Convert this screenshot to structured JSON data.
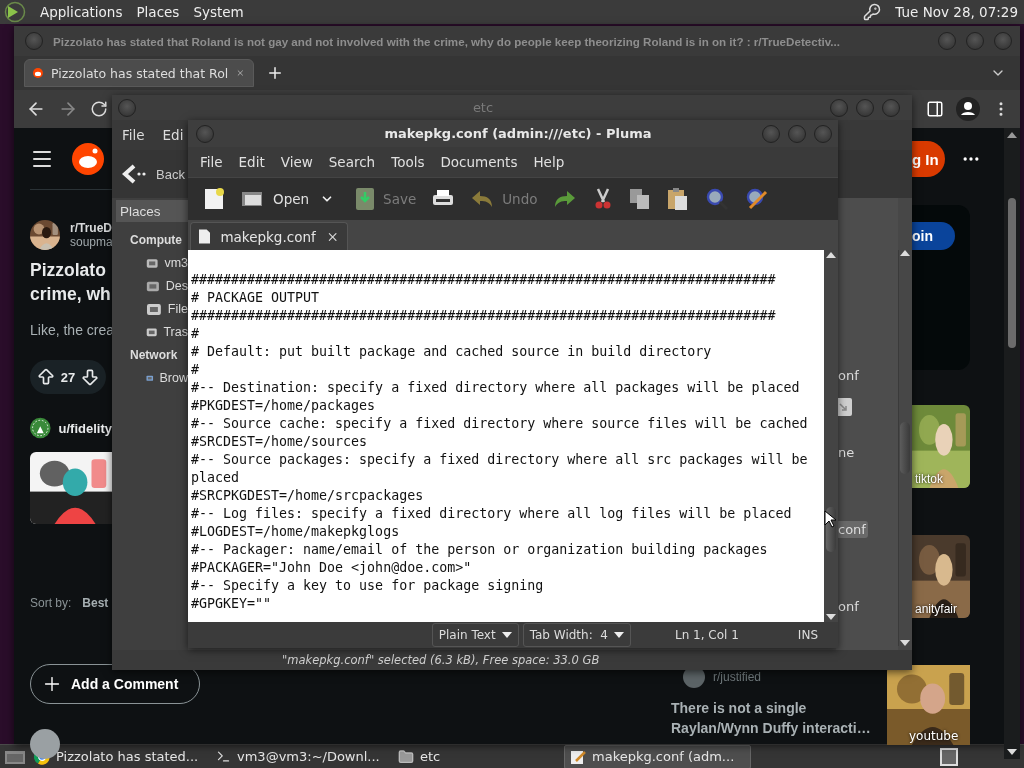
{
  "top_panel": {
    "menus": [
      "Applications",
      "Places",
      "System"
    ],
    "clock": "Tue Nov 28, 07:29"
  },
  "browser": {
    "title": "Pizzolato has stated that Roland is not gay and not involved with the crime, why do people keep theorizing Roland is in on it? : r/TrueDetectiv...",
    "tabs": [
      {
        "title": "Pizzolato has stated that Rol",
        "selected": true
      }
    ],
    "post": {
      "subreddit": "r/TrueD",
      "author": "soupma",
      "title_lines": [
        "Pizzolato",
        "crime, wh"
      ],
      "body": "Like, the crea",
      "votes": "27"
    },
    "ad": {
      "user": "u/fidelity"
    },
    "sort": {
      "label": "Sort by:",
      "value": "Best"
    },
    "add_comment": "Add a Comment",
    "login": "g In",
    "join": "oin",
    "videos": [
      {
        "source": "tiktok"
      },
      {
        "source": "anityfair"
      }
    ],
    "related": {
      "community": "r/justified",
      "title_lines": [
        "There is not a single",
        "Raylan/Wynn Duffy interacti…"
      ],
      "video": "youtube"
    }
  },
  "file_manager": {
    "title": "etc",
    "menus": [
      "File",
      "Edi"
    ],
    "back": "Back",
    "sidebar_header": "Places",
    "sections": [
      {
        "heading": "Compute",
        "items": [
          {
            "label": "vm3",
            "kind": "home"
          },
          {
            "label": "Des",
            "kind": "desktop"
          },
          {
            "label": "File",
            "kind": "drive"
          },
          {
            "label": "Tras",
            "kind": "trash"
          }
        ]
      },
      {
        "heading": "Network",
        "items": [
          {
            "label": "Brow",
            "kind": "network"
          }
        ]
      }
    ],
    "files": [
      {
        "label": "onf",
        "icon": false,
        "selected": false
      },
      {
        "label": "ne",
        "icon": true,
        "selected": false
      },
      {
        "label": "conf",
        "icon": false,
        "selected": true
      },
      {
        "label": "onf",
        "icon": false,
        "selected": false
      }
    ],
    "status": "\"makepkg.conf\" selected (6.3 kB), Free space: 33.0 GB"
  },
  "editor": {
    "title": "makepkg.conf (admin:///etc) - Pluma",
    "menus": [
      "File",
      "Edit",
      "View",
      "Search",
      "Tools",
      "Documents",
      "Help"
    ],
    "toolbar": [
      {
        "kind": "new"
      },
      {
        "kind": "open",
        "label": "Open",
        "disabled": false
      },
      {
        "kind": "dropdown"
      },
      {
        "kind": "save",
        "label": "Save",
        "disabled": true
      },
      {
        "kind": "print"
      },
      {
        "kind": "undo",
        "label": "Undo",
        "disabled": true
      },
      {
        "kind": "redo"
      },
      {
        "kind": "cut"
      },
      {
        "kind": "copy"
      },
      {
        "kind": "paste"
      },
      {
        "kind": "find"
      },
      {
        "kind": "replace"
      }
    ],
    "documents": [
      {
        "name": "makepkg.conf",
        "selected": true
      }
    ],
    "lines": [
      "#########################################################################",
      "# PACKAGE OUTPUT",
      "#########################################################################",
      "#",
      "# Default: put built package and cached source in build directory",
      "#",
      "#-- Destination: specify a fixed directory where all packages will be placed",
      "#PKGDEST=/home/packages",
      "#-- Source cache: specify a fixed directory where source files will be cached",
      "#SRCDEST=/home/sources",
      "#-- Source packages: specify a fixed directory where all src packages will be",
      "placed",
      "#SRCPKGDEST=/home/srcpackages",
      "#-- Log files: specify a fixed directory where all log files will be placed",
      "#LOGDEST=/home/makepkglogs",
      "#-- Packager: name/email of the person or organization building packages",
      "#PACKAGER=\"John Doe <john@doe.com>\"",
      "#-- Specify a key to use for package signing",
      "#GPGKEY=\"\""
    ],
    "status": {
      "language": "Plain Text",
      "tab_width": "Tab Width:  4",
      "position": "Ln 1, Col 1",
      "mode": "INS"
    }
  },
  "taskbar": {
    "items": [
      {
        "kind": "browser",
        "label": "Pizzolato has stated...",
        "selected": false
      },
      {
        "kind": "terminal",
        "label": "vm3@vm3:~/Downl...",
        "selected": false
      },
      {
        "kind": "folder",
        "label": "etc",
        "selected": false
      },
      {
        "kind": "editor",
        "label": "makepkg.conf (adm...",
        "selected": true
      }
    ]
  }
}
